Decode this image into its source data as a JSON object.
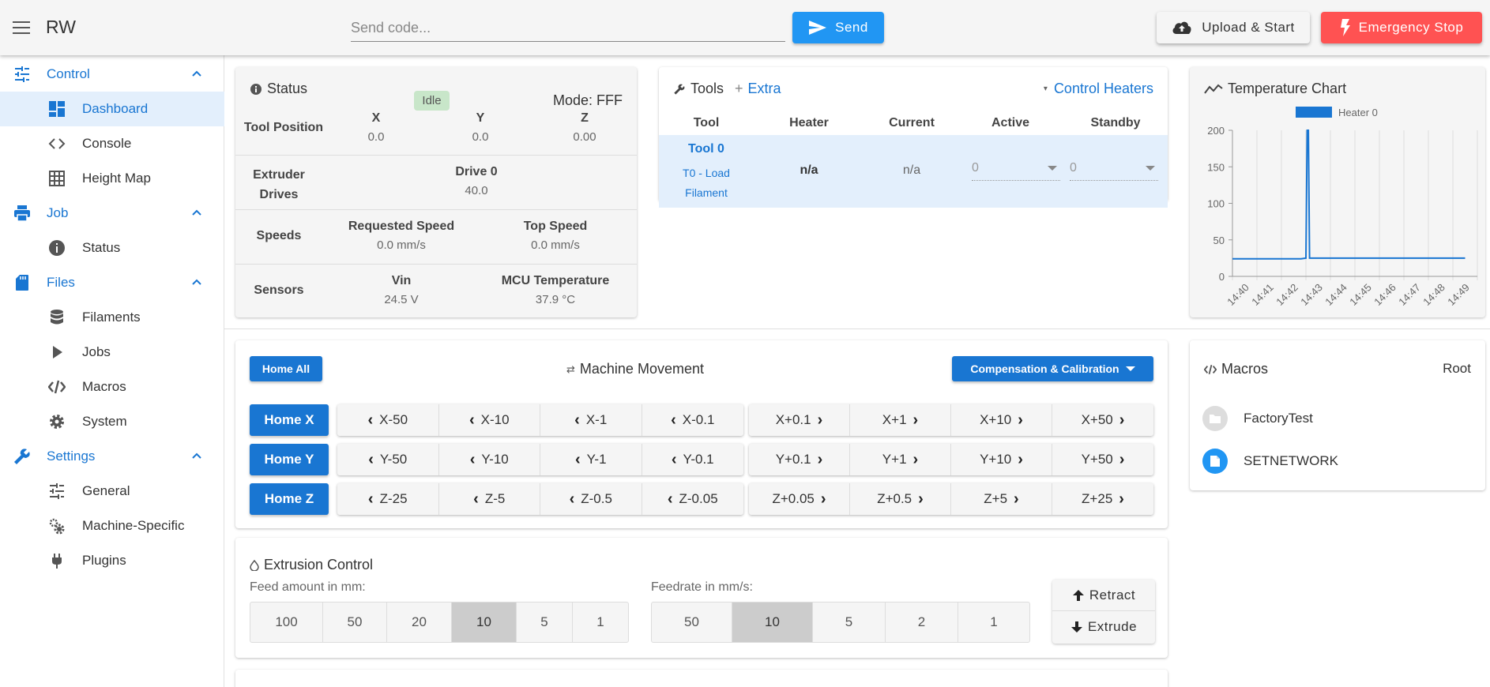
{
  "app": {
    "title": "RW"
  },
  "header": {
    "code_placeholder": "Send code...",
    "send_label": "Send",
    "upload_label": "Upload & Start",
    "estop_label": "Emergency Stop"
  },
  "sidebar": {
    "groups": [
      {
        "label": "Control",
        "icon": "sliders-icon",
        "items": [
          {
            "label": "Dashboard",
            "icon": "dashboard-icon",
            "active": true
          },
          {
            "label": "Console",
            "icon": "code-brackets-icon"
          },
          {
            "label": "Height Map",
            "icon": "grid-icon"
          }
        ]
      },
      {
        "label": "Job",
        "icon": "printer-icon",
        "items": [
          {
            "label": "Status",
            "icon": "info-icon"
          }
        ]
      },
      {
        "label": "Files",
        "icon": "sd-card-icon",
        "items": [
          {
            "label": "Filaments",
            "icon": "database-icon"
          },
          {
            "label": "Jobs",
            "icon": "play-icon"
          },
          {
            "label": "Macros",
            "icon": "code-slash-icon"
          },
          {
            "label": "System",
            "icon": "gear-icon"
          }
        ]
      },
      {
        "label": "Settings",
        "icon": "wrench-icon",
        "items": [
          {
            "label": "General",
            "icon": "tune-icon"
          },
          {
            "label": "Machine-Specific",
            "icon": "gears-icon"
          },
          {
            "label": "Plugins",
            "icon": "plug-icon"
          }
        ]
      }
    ]
  },
  "status": {
    "title": "Status",
    "state": "Idle",
    "mode": "Mode: FFF",
    "tool_position": {
      "label": "Tool Position",
      "axes": [
        {
          "name": "X",
          "value": "0.0"
        },
        {
          "name": "Y",
          "value": "0.0"
        },
        {
          "name": "Z",
          "value": "0.00"
        }
      ]
    },
    "extruder": {
      "label_line1": "Extruder",
      "label_line2": "Drives",
      "drive_name": "Drive 0",
      "drive_value": "40.0"
    },
    "speeds": {
      "label": "Speeds",
      "requested_label": "Requested Speed",
      "requested_value": "0.0 mm/s",
      "top_label": "Top Speed",
      "top_value": "0.0 mm/s"
    },
    "sensors": {
      "label": "Sensors",
      "vin_label": "Vin",
      "vin_value": "24.5 V",
      "mcu_label": "MCU Temperature",
      "mcu_value": "37.9 °C"
    }
  },
  "tools": {
    "title": "Tools",
    "extra_label": "Extra",
    "control_heaters_label": "Control Heaters",
    "columns": [
      "Tool",
      "Heater",
      "Current",
      "Active",
      "Standby"
    ],
    "rows": [
      {
        "tool_name": "Tool 0",
        "tool_sub1": "T0 - Load",
        "tool_sub2": "Filament",
        "heater": "n/a",
        "current": "n/a",
        "active": "0",
        "standby": "0"
      }
    ]
  },
  "temperature_chart": {
    "title": "Temperature Chart"
  },
  "chart_data": {
    "type": "line",
    "legend": [
      "Heater 0"
    ],
    "x_ticks": [
      "14:40",
      "14:41",
      "14:42",
      "14:43",
      "14:44",
      "14:45",
      "14:46",
      "14:47",
      "14:48",
      "14:49"
    ],
    "y_ticks": [
      "200",
      "150",
      "100",
      "50",
      "0"
    ],
    "ylim": [
      0,
      200
    ],
    "series": [
      {
        "name": "Heater 0",
        "color": "#1976d2",
        "points": [
          [
            0,
            24
          ],
          [
            1,
            24
          ],
          [
            2,
            24
          ],
          [
            2.8,
            24
          ],
          [
            3,
            25
          ],
          [
            3.05,
            200
          ],
          [
            3.1,
            200
          ],
          [
            3.15,
            25
          ],
          [
            4,
            25
          ],
          [
            5,
            25
          ],
          [
            6,
            25
          ],
          [
            7,
            25
          ],
          [
            8,
            25
          ],
          [
            9,
            25
          ],
          [
            9.5,
            25
          ]
        ]
      }
    ]
  },
  "movement": {
    "home_all_label": "Home All",
    "title": "Machine Movement",
    "comp_label": "Compensation & Calibration",
    "rows": [
      {
        "home_label": "Home X",
        "minus": [
          "X-50",
          "X-10",
          "X-1",
          "X-0.1"
        ],
        "plus": [
          "X+0.1",
          "X+1",
          "X+10",
          "X+50"
        ]
      },
      {
        "home_label": "Home Y",
        "minus": [
          "Y-50",
          "Y-10",
          "Y-1",
          "Y-0.1"
        ],
        "plus": [
          "Y+0.1",
          "Y+1",
          "Y+10",
          "Y+50"
        ]
      },
      {
        "home_label": "Home Z",
        "minus": [
          "Z-25",
          "Z-5",
          "Z-0.5",
          "Z-0.05"
        ],
        "plus": [
          "Z+0.05",
          "Z+0.5",
          "Z+5",
          "Z+25"
        ]
      }
    ]
  },
  "macros": {
    "title": "Macros",
    "root_label": "Root",
    "items": [
      {
        "label": "FactoryTest",
        "icon": "folder-icon"
      },
      {
        "label": "SETNETWORK",
        "icon": "file-icon"
      }
    ]
  },
  "extrusion": {
    "title": "Extrusion Control",
    "feed_label": "Feed amount in mm:",
    "feed_values": [
      "100",
      "50",
      "20",
      "10",
      "5",
      "1"
    ],
    "feed_selected": "10",
    "rate_label": "Feedrate in mm/s:",
    "rate_values": [
      "50",
      "10",
      "5",
      "2",
      "1"
    ],
    "rate_selected": "10",
    "retract_label": "Retract",
    "extrude_label": "Extrude"
  },
  "colors": {
    "accent": "#1976d2",
    "send": "#2196f3",
    "estop": "#ff5252",
    "idle_badge": "#c8e6c9",
    "active_bg": "#e3effc"
  }
}
